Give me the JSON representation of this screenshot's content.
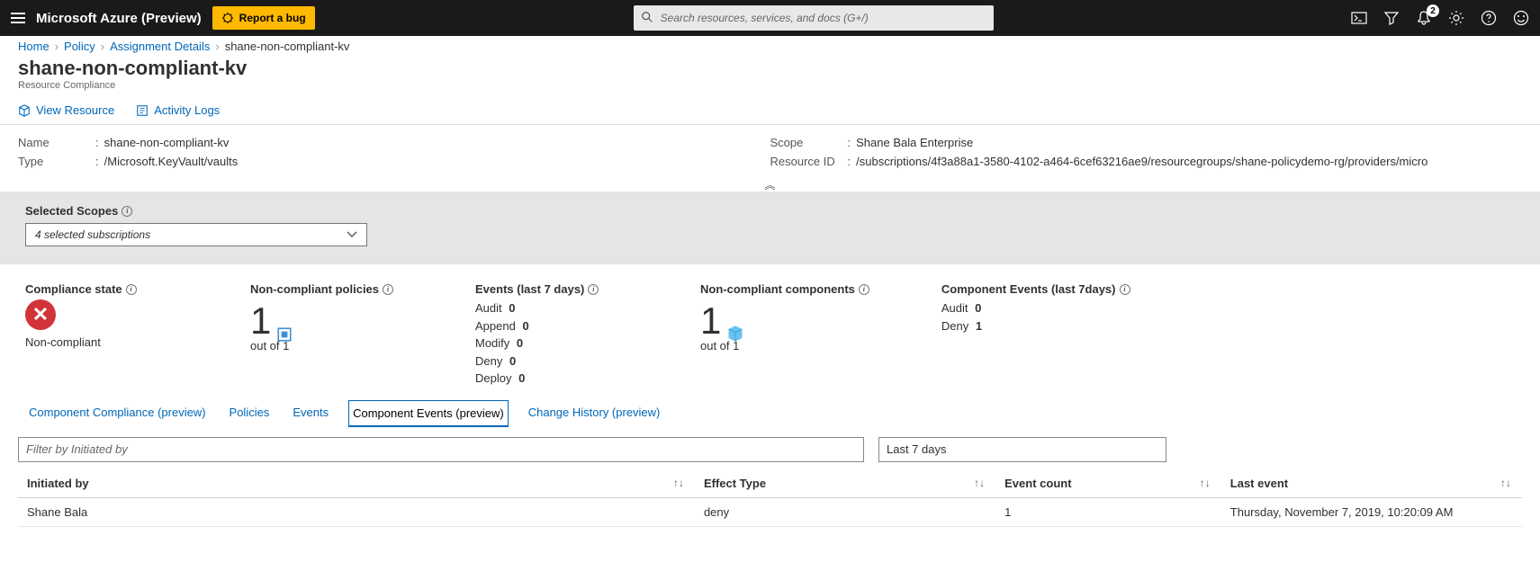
{
  "topbar": {
    "brand": "Microsoft Azure (Preview)",
    "report_bug": "Report a bug",
    "search_placeholder": "Search resources, services, and docs (G+/)",
    "notification_count": "2"
  },
  "breadcrumb": {
    "items": [
      "Home",
      "Policy",
      "Assignment Details"
    ],
    "current": "shane-non-compliant-kv"
  },
  "page": {
    "title": "shane-non-compliant-kv",
    "subtitle": "Resource Compliance",
    "cmd_view_resource": "View Resource",
    "cmd_activity_logs": "Activity Logs"
  },
  "essentials": {
    "left": {
      "name_label": "Name",
      "name_value": "shane-non-compliant-kv",
      "type_label": "Type",
      "type_value": "/Microsoft.KeyVault/vaults"
    },
    "right": {
      "scope_label": "Scope",
      "scope_value": "Shane Bala Enterprise",
      "resid_label": "Resource ID",
      "resid_value": "/subscriptions/4f3a88a1-3580-4102-a464-6cef63216ae9/resourcegroups/shane-policydemo-rg/providers/micro"
    }
  },
  "scopes": {
    "label": "Selected Scopes",
    "value": "4 selected subscriptions"
  },
  "tiles": {
    "compliance_state": {
      "label": "Compliance state",
      "value": "Non-compliant"
    },
    "noncompliant_policies": {
      "label": "Non-compliant policies",
      "num": "1",
      "outof": "out of 1"
    },
    "events7": {
      "label": "Events (last 7 days)",
      "rows": [
        {
          "k": "Audit",
          "v": "0"
        },
        {
          "k": "Append",
          "v": "0"
        },
        {
          "k": "Modify",
          "v": "0"
        },
        {
          "k": "Deny",
          "v": "0"
        },
        {
          "k": "Deploy",
          "v": "0"
        }
      ]
    },
    "noncompliant_components": {
      "label": "Non-compliant components",
      "num": "1",
      "outof": "out of 1"
    },
    "component_events7": {
      "label": "Component Events (last 7days)",
      "rows": [
        {
          "k": "Audit",
          "v": "0"
        },
        {
          "k": "Deny",
          "v": "1"
        }
      ]
    }
  },
  "tabs": [
    {
      "label": "Component Compliance (preview)",
      "active": false
    },
    {
      "label": "Policies",
      "active": false
    },
    {
      "label": "Events",
      "active": false
    },
    {
      "label": "Component Events (preview)",
      "active": true
    },
    {
      "label": "Change History (preview)",
      "active": false
    }
  ],
  "filters": {
    "initiated_placeholder": "Filter by Initiated by",
    "timerange": "Last 7 days"
  },
  "table": {
    "headers": [
      "Initiated by",
      "Effect Type",
      "Event count",
      "Last event"
    ],
    "rows": [
      {
        "initiated_by": "Shane Bala",
        "effect_type": "deny",
        "event_count": "1",
        "last_event": "Thursday, November 7, 2019, 10:20:09 AM"
      }
    ]
  }
}
